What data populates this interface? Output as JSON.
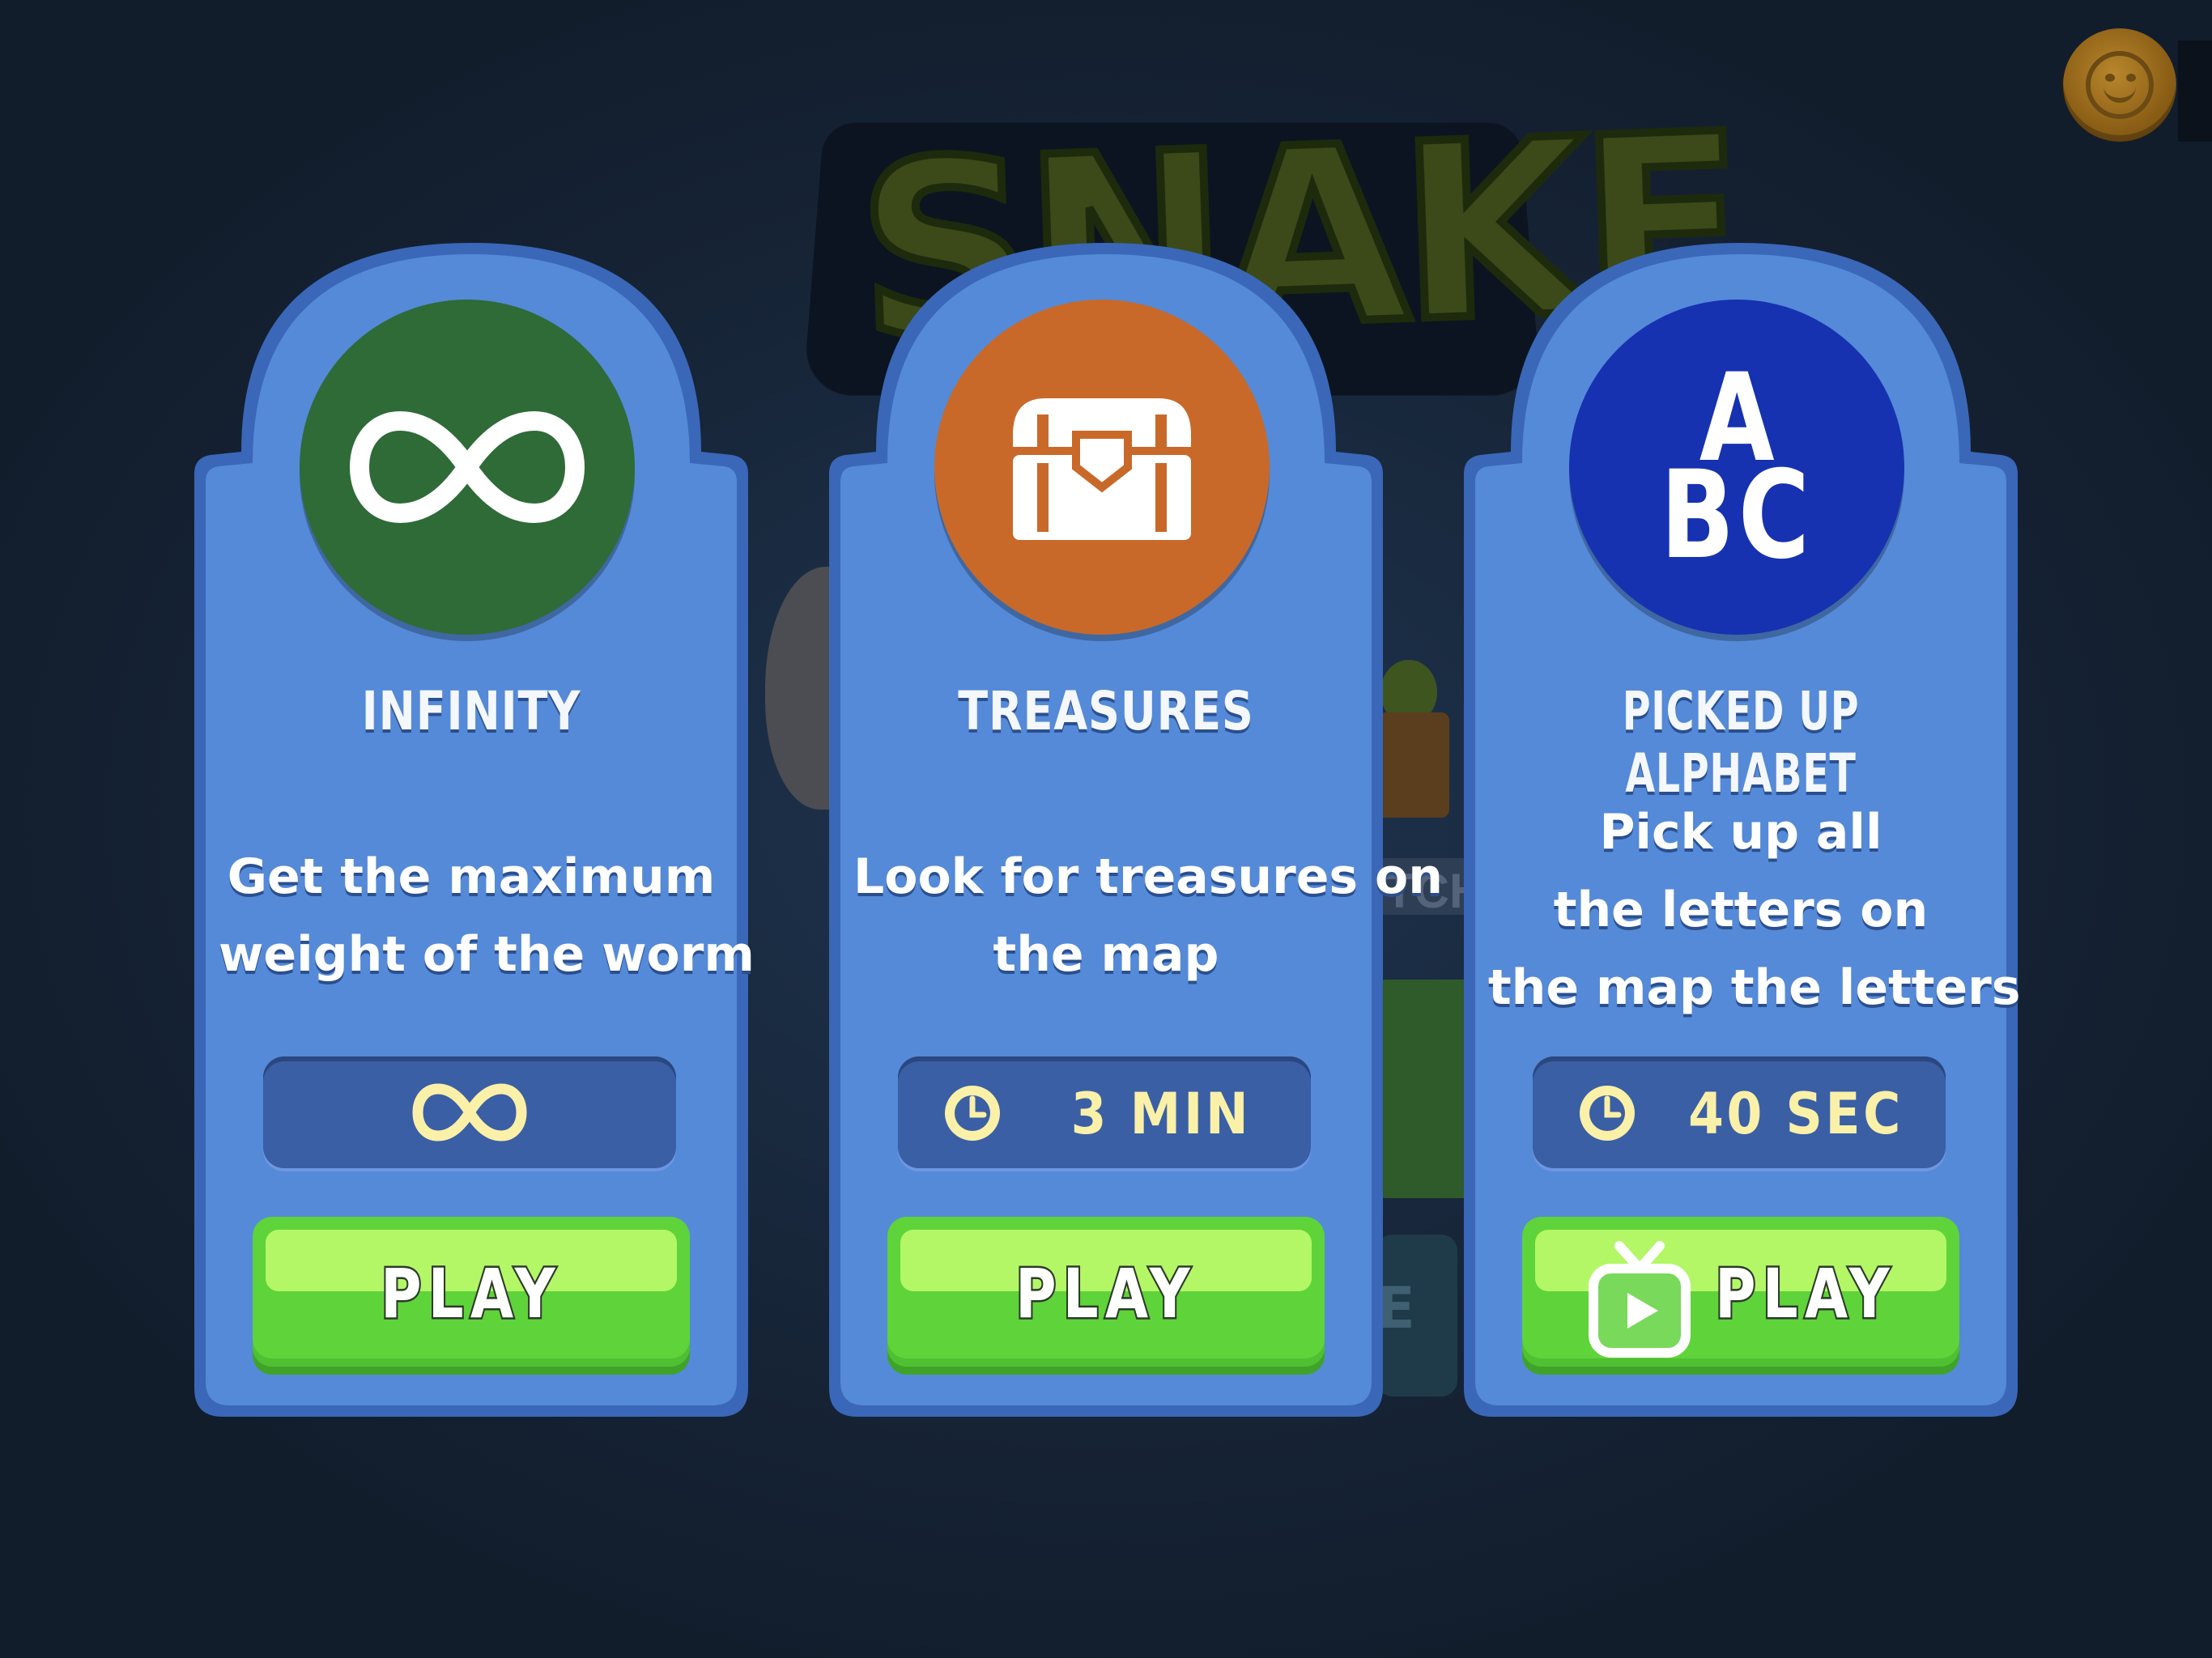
{
  "background": {
    "logo_text": "SNAKE",
    "partial_label": "TCH",
    "partial_label2": "E"
  },
  "colors": {
    "card_fill": "#548ad8",
    "card_border": "#3a67b8",
    "play_green": "#5fd33a",
    "timer_text": "#fbf0a8"
  },
  "modes": [
    {
      "title": "INFINITY",
      "description_lines": [
        "Get the maximum",
        "weight of the worm"
      ],
      "duration": "",
      "icon": "infinity-icon",
      "circle_color": "#2e6b37",
      "play_label": "PLAY"
    },
    {
      "title": "TREASURES",
      "description_lines": [
        "Look for treasures on",
        "the map"
      ],
      "duration": "3 MIN",
      "icon": "treasure-chest-icon",
      "circle_color": "#c8692a",
      "play_label": "PLAY"
    },
    {
      "title": "PICKED  UP ALPHABET",
      "description_lines": [
        "Pick up all",
        "the letters on",
        "the map the letters"
      ],
      "duration": "40 SEC",
      "icon": "abc-icon",
      "icon_text": [
        "A",
        "BC"
      ],
      "circle_color": "#1632b0",
      "play_label": "PLAY"
    }
  ]
}
